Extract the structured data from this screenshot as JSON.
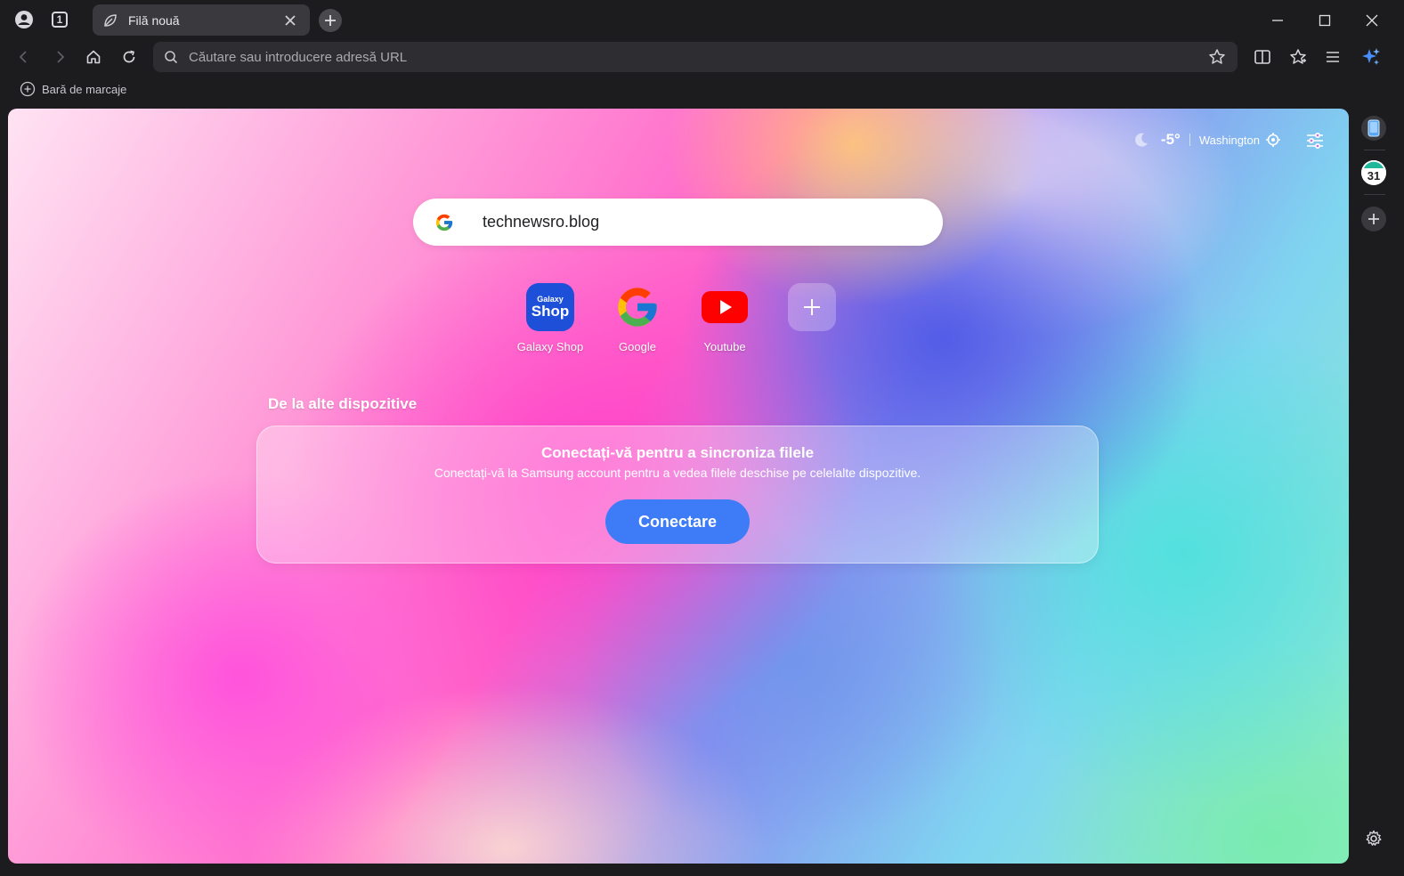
{
  "tabbar": {
    "profile_icon": "profile-icon",
    "tab_count": "1",
    "active_tab_title": "Filă nouă",
    "new_tab_icon": "plus-icon",
    "window_controls": [
      "minimize-icon",
      "maximize-icon",
      "close-icon"
    ]
  },
  "toolbar": {
    "address_placeholder": "Căutare sau introducere adresă URL",
    "icons": [
      "back-icon",
      "forward-icon",
      "home-icon",
      "reload-icon",
      "bookmark-star-icon",
      "split-view-icon",
      "favorites-icon",
      "menu-icon",
      "ai-sparkle-icon"
    ]
  },
  "bookmarks_bar": {
    "label": "Bară de marcaje"
  },
  "newtab": {
    "weather": {
      "temperature": "-5°",
      "city": "Washington"
    },
    "search": {
      "value": "technewsro.blog"
    },
    "shortcuts": [
      {
        "label": "Galaxy Shop",
        "tile_line1": "Galaxy",
        "tile_line2": "Shop"
      },
      {
        "label": "Google"
      },
      {
        "label": "Youtube"
      }
    ],
    "devices_section_title": "De la alte dispozitive",
    "sync_card": {
      "heading": "Conectați-vă pentru a sincroniza filele",
      "text": "Conectați-vă la Samsung account pentru a vedea filele deschise pe celelalte dispozitive.",
      "button": "Conectare"
    }
  },
  "sidepanel": {
    "calendar_day": "31"
  },
  "colors": {
    "accent_button": "#3d7bf7",
    "galaxy_tile": "#1d4fd8",
    "youtube_red": "#ff0000",
    "chrome_bg": "#1c1c1f"
  }
}
